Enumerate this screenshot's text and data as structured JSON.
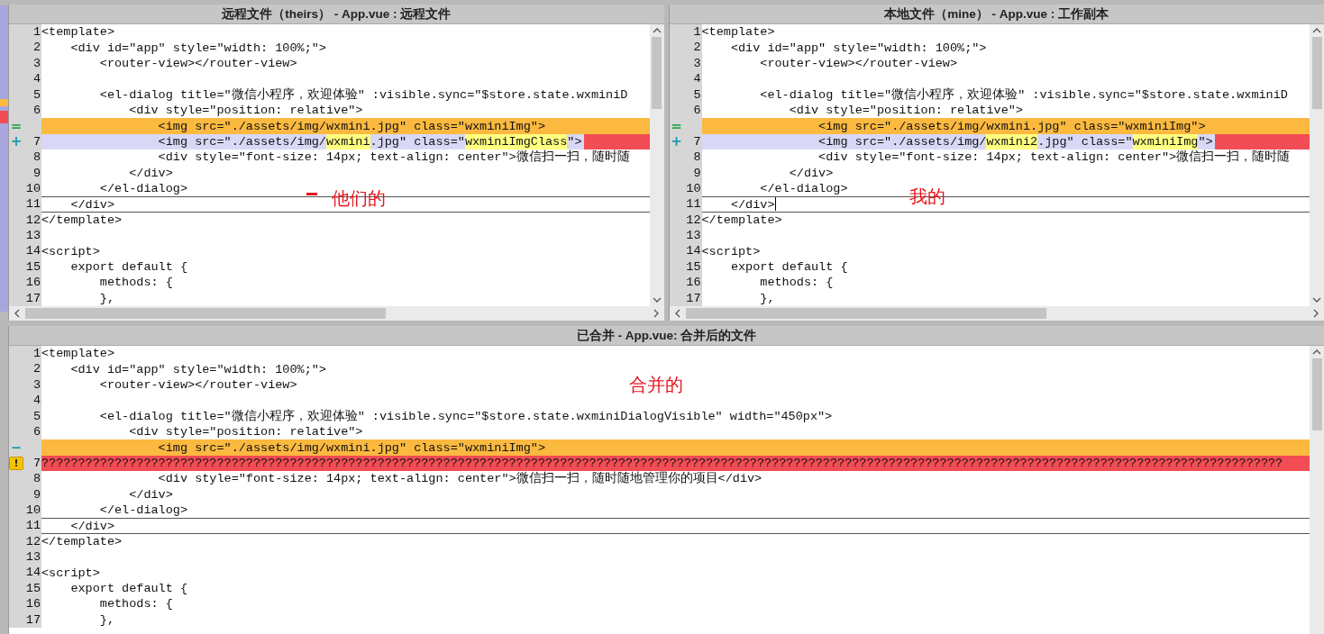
{
  "panes": [
    {
      "kind": "theirs",
      "title": "远程文件（theirs） - App.vue : 远程文件",
      "annotation": {
        "text": "他们的",
        "dash": true
      },
      "lines": [
        {
          "number": "1",
          "kind": "plain",
          "segments": [
            {
              "text": "<template>",
              "highlight": false
            }
          ]
        },
        {
          "number": "2",
          "kind": "plain",
          "segments": [
            {
              "text": "    <div id=\"app\" style=\"width: 100%;\">",
              "highlight": false
            }
          ]
        },
        {
          "number": "3",
          "kind": "plain",
          "segments": [
            {
              "text": "        <router-view></router-view>",
              "highlight": false
            }
          ]
        },
        {
          "number": "4",
          "kind": "plain"
        },
        {
          "number": "5",
          "kind": "plain",
          "segments": [
            {
              "text": "        <el-dialog title=\"微信小程序，欢迎体验\" :visible.sync=\"$store.state.wxminiD",
              "highlight": false
            }
          ]
        },
        {
          "number": "6",
          "kind": "plain",
          "segments": [
            {
              "text": "            <div style=\"position: relative\">",
              "highlight": false
            }
          ]
        },
        {
          "kind": "base",
          "marker": {
            "kind": "equal",
            "text": "="
          },
          "segments": [
            {
              "text": "                <img src=\"./assets/img/wxmini.jpg\" class=\"wxminiImg\">",
              "highlight": false
            }
          ]
        },
        {
          "number": "7",
          "kind": "changed",
          "marker": {
            "kind": "plus",
            "text": "+"
          },
          "segments": [
            {
              "text": "                <img src=\"./assets/img/",
              "highlight": false
            },
            {
              "text": "wxmini",
              "highlight": true
            },
            {
              "text": ".jpg\" class=\"",
              "highlight": false
            },
            {
              "text": "wxminiImgClass",
              "highlight": true
            },
            {
              "text": "\">",
              "highlight": false
            }
          ]
        },
        {
          "number": "8",
          "kind": "plain",
          "segments": [
            {
              "text": "                <div style=\"font-size: 14px; text-align: center\">微信扫一扫，随时随",
              "highlight": false
            }
          ]
        },
        {
          "number": "9",
          "kind": "plain",
          "segments": [
            {
              "text": "            </div>",
              "highlight": false
            }
          ]
        },
        {
          "number": "10",
          "kind": "plain",
          "segments": [
            {
              "text": "        </el-dialog>",
              "highlight": false
            }
          ]
        },
        {
          "number": "11",
          "kind": "plain",
          "current": true,
          "segments": [
            {
              "text": "    </div>",
              "highlight": false
            }
          ]
        },
        {
          "number": "12",
          "kind": "plain",
          "segments": [
            {
              "text": "</template>",
              "highlight": false
            }
          ]
        },
        {
          "number": "13",
          "kind": "plain"
        },
        {
          "number": "14",
          "kind": "plain",
          "segments": [
            {
              "text": "<script>",
              "highlight": false
            }
          ]
        },
        {
          "number": "15",
          "kind": "plain",
          "segments": [
            {
              "text": "    export default {",
              "highlight": false
            }
          ]
        },
        {
          "number": "16",
          "kind": "plain",
          "segments": [
            {
              "text": "        methods: {",
              "highlight": false
            }
          ]
        },
        {
          "number": "17",
          "kind": "plain",
          "segments": [
            {
              "text": "        },",
              "highlight": false
            }
          ]
        }
      ]
    },
    {
      "kind": "mine",
      "title": "本地文件（mine） - App.vue : 工作副本",
      "annotation": {
        "text": "我的"
      },
      "lines": [
        {
          "number": "1",
          "kind": "plain",
          "segments": [
            {
              "text": "<template>",
              "highlight": false
            }
          ]
        },
        {
          "number": "2",
          "kind": "plain",
          "segments": [
            {
              "text": "    <div id=\"app\" style=\"width: 100%;\">",
              "highlight": false
            }
          ]
        },
        {
          "number": "3",
          "kind": "plain",
          "segments": [
            {
              "text": "        <router-view></router-view>",
              "highlight": false
            }
          ]
        },
        {
          "number": "4",
          "kind": "plain"
        },
        {
          "number": "5",
          "kind": "plain",
          "segments": [
            {
              "text": "        <el-dialog title=\"微信小程序，欢迎体验\" :visible.sync=\"$store.state.wxminiD",
              "highlight": false
            }
          ]
        },
        {
          "number": "6",
          "kind": "plain",
          "segments": [
            {
              "text": "            <div style=\"position: relative\">",
              "highlight": false
            }
          ]
        },
        {
          "kind": "base",
          "marker": {
            "kind": "equal",
            "text": "="
          },
          "segments": [
            {
              "text": "                <img src=\"./assets/img/wxmini.jpg\" class=\"wxminiImg\">",
              "highlight": false
            }
          ]
        },
        {
          "number": "7",
          "kind": "changed",
          "marker": {
            "kind": "plus",
            "text": "+"
          },
          "segments": [
            {
              "text": "                <img src=\"./assets/img/",
              "highlight": false
            },
            {
              "text": "wxmini2",
              "highlight": true
            },
            {
              "text": ".jpg\" class=\"",
              "highlight": false
            },
            {
              "text": "wxminiImg",
              "highlight": true
            },
            {
              "text": "\">",
              "highlight": false
            }
          ]
        },
        {
          "number": "8",
          "kind": "plain",
          "segments": [
            {
              "text": "                <div style=\"font-size: 14px; text-align: center\">微信扫一扫，随时随",
              "highlight": false
            }
          ]
        },
        {
          "number": "9",
          "kind": "plain",
          "segments": [
            {
              "text": "            </div>",
              "highlight": false
            }
          ]
        },
        {
          "number": "10",
          "kind": "plain",
          "segments": [
            {
              "text": "        </el-dialog>",
              "highlight": false
            }
          ]
        },
        {
          "number": "11",
          "kind": "plain",
          "current": true,
          "caret": true,
          "segments": [
            {
              "text": "    </div>",
              "highlight": false
            }
          ]
        },
        {
          "number": "12",
          "kind": "plain",
          "segments": [
            {
              "text": "</template>",
              "highlight": false
            }
          ]
        },
        {
          "number": "13",
          "kind": "plain"
        },
        {
          "number": "14",
          "kind": "plain",
          "segments": [
            {
              "text": "<script>",
              "highlight": false
            }
          ]
        },
        {
          "number": "15",
          "kind": "plain",
          "segments": [
            {
              "text": "    export default {",
              "highlight": false
            }
          ]
        },
        {
          "number": "16",
          "kind": "plain",
          "segments": [
            {
              "text": "        methods: {",
              "highlight": false
            }
          ]
        },
        {
          "number": "17",
          "kind": "plain",
          "segments": [
            {
              "text": "        },",
              "highlight": false
            }
          ]
        }
      ]
    },
    {
      "kind": "merged",
      "title": "已合并 - App.vue: 合并后的文件",
      "annotation": {
        "text": "合并的"
      },
      "lines": [
        {
          "number": "1",
          "kind": "plain",
          "segments": [
            {
              "text": "<template>",
              "highlight": false
            }
          ]
        },
        {
          "number": "2",
          "kind": "plain",
          "segments": [
            {
              "text": "    <div id=\"app\" style=\"width: 100%;\">",
              "highlight": false
            }
          ]
        },
        {
          "number": "3",
          "kind": "plain",
          "segments": [
            {
              "text": "        <router-view></router-view>",
              "highlight": false
            }
          ]
        },
        {
          "number": "4",
          "kind": "plain"
        },
        {
          "number": "5",
          "kind": "plain",
          "segments": [
            {
              "text": "        <el-dialog title=\"微信小程序，欢迎体验\" :visible.sync=\"$store.state.wxminiDialogVisible\" width=\"450px\">",
              "highlight": false
            }
          ]
        },
        {
          "number": "6",
          "kind": "plain",
          "segments": [
            {
              "text": "            <div style=\"position: relative\">",
              "highlight": false
            }
          ]
        },
        {
          "kind": "base",
          "marker": {
            "kind": "minus",
            "text": "−"
          },
          "segments": [
            {
              "text": "                <img src=\"./assets/img/wxmini.jpg\" class=\"wxminiImg\">",
              "highlight": false
            }
          ]
        },
        {
          "number": "7",
          "kind": "conflict",
          "marker": {
            "kind": "warning",
            "text": "!"
          },
          "segments": [
            {
              "text": "??????????????????????????????????????????????????????????????????????????????????????????????????????????????????????????????????????????????????????????????????????????",
              "highlight": false
            }
          ]
        },
        {
          "number": "8",
          "kind": "plain",
          "segments": [
            {
              "text": "                <div style=\"font-size: 14px; text-align: center\">微信扫一扫，随时随地管理你的项目</div>",
              "highlight": false
            }
          ]
        },
        {
          "number": "9",
          "kind": "plain",
          "segments": [
            {
              "text": "            </div>",
              "highlight": false
            }
          ]
        },
        {
          "number": "10",
          "kind": "plain",
          "segments": [
            {
              "text": "        </el-dialog>",
              "highlight": false
            }
          ]
        },
        {
          "number": "11",
          "kind": "plain",
          "current": true,
          "segments": [
            {
              "text": "    </div>",
              "highlight": false
            }
          ]
        },
        {
          "number": "12",
          "kind": "plain",
          "segments": [
            {
              "text": "</template>",
              "highlight": false
            }
          ]
        },
        {
          "number": "13",
          "kind": "plain"
        },
        {
          "number": "14",
          "kind": "plain",
          "segments": [
            {
              "text": "<script>",
              "highlight": false
            }
          ]
        },
        {
          "number": "15",
          "kind": "plain",
          "segments": [
            {
              "text": "    export default {",
              "highlight": false
            }
          ]
        },
        {
          "number": "16",
          "kind": "plain",
          "segments": [
            {
              "text": "        methods: {",
              "highlight": false
            }
          ]
        },
        {
          "number": "17",
          "kind": "plain",
          "segments": [
            {
              "text": "        },",
              "highlight": false
            }
          ]
        }
      ]
    }
  ]
}
